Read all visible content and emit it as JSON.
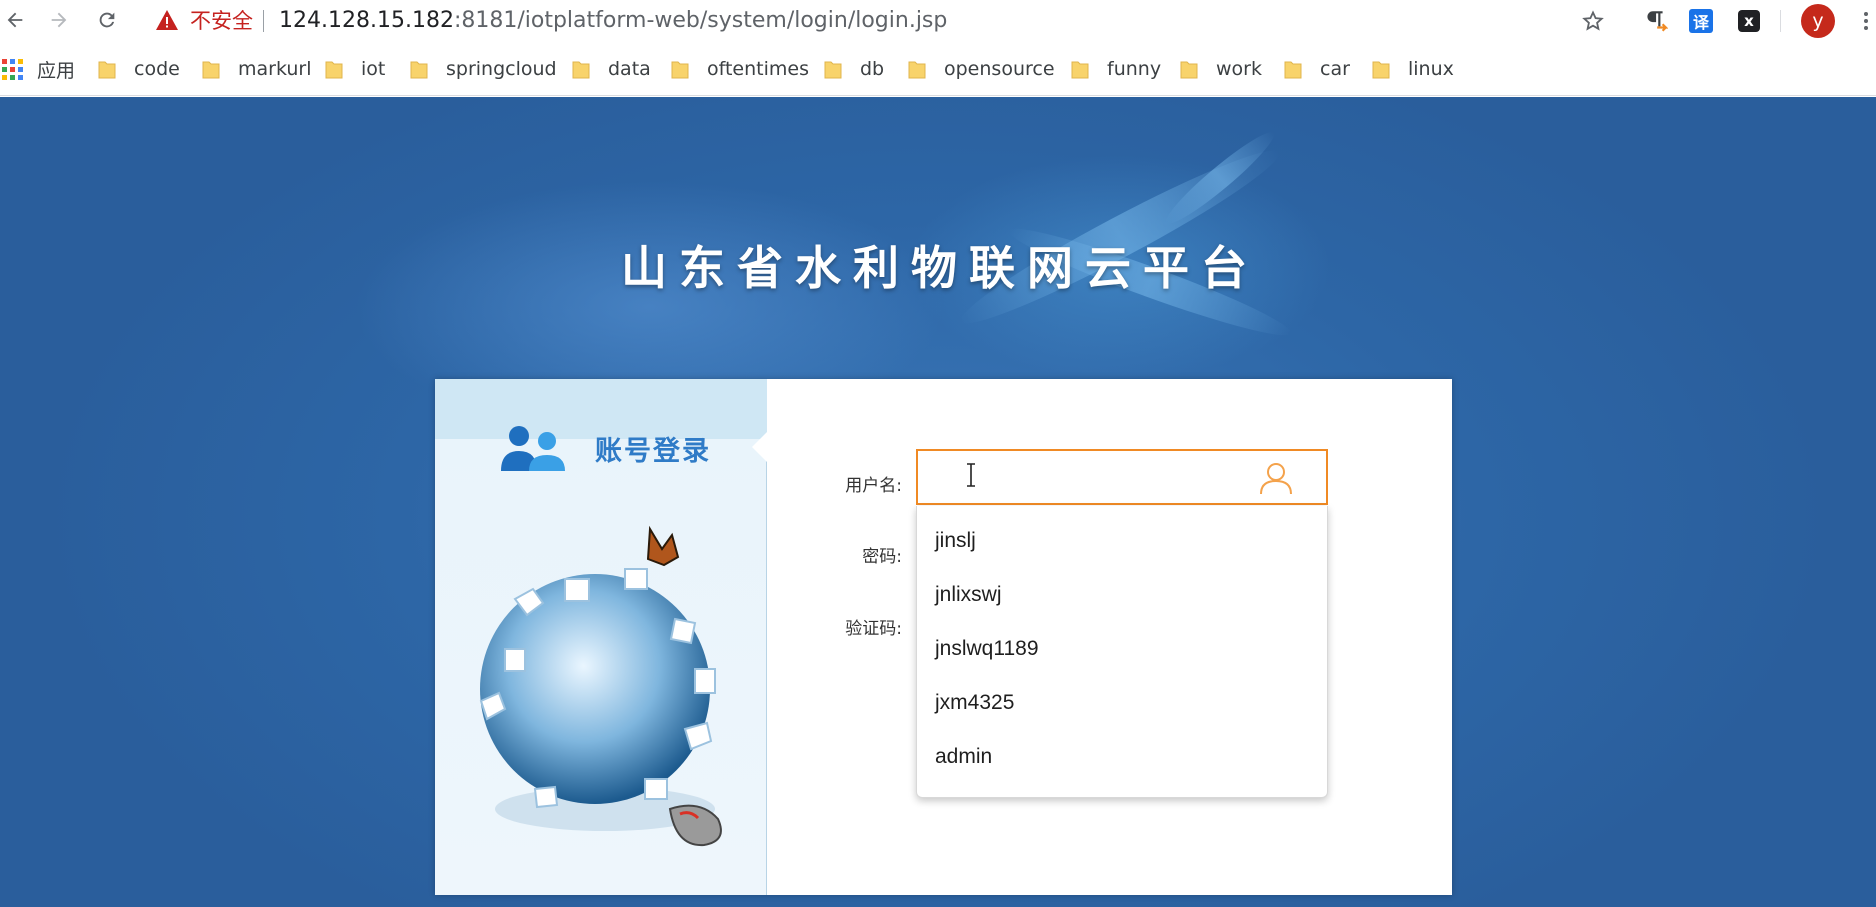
{
  "browser": {
    "security_label": "不安全",
    "url_host": "124.128.15.182",
    "url_rest": ":8181/iotplatform-web/system/login/login.jsp",
    "avatar_letter": "y",
    "translate_ext": "译",
    "x_ext": "x",
    "icons": [
      "back-icon",
      "forward-icon",
      "reload-icon",
      "warning-icon",
      "star-icon",
      "pilcrow-icon",
      "translate-icon",
      "x-extension-icon",
      "menu-dots-icon"
    ]
  },
  "bookmarks": {
    "apps_label": "应用",
    "items": [
      {
        "label": "code"
      },
      {
        "label": "markurl"
      },
      {
        "label": "iot"
      },
      {
        "label": "springcloud"
      },
      {
        "label": "data"
      },
      {
        "label": "oftentimes"
      },
      {
        "label": "db"
      },
      {
        "label": "opensource"
      },
      {
        "label": "funny"
      },
      {
        "label": "work"
      },
      {
        "label": "car"
      },
      {
        "label": "linux"
      }
    ]
  },
  "page": {
    "title": "山东省水利物联网云平台",
    "login_tab": "账号登录",
    "labels": {
      "username": "用户名:",
      "password": "密码:",
      "captcha": "验证码:"
    },
    "username_value": "",
    "suggestions": [
      "jinslj",
      "jnlixswj",
      "jnslwq1189",
      "jxm4325",
      "admin"
    ]
  },
  "colors": {
    "page_blue": "#2d66a6",
    "focus_orange": "#f08a24",
    "warning_red": "#c5221f",
    "avatar_red": "#c5291b",
    "tab_text_blue": "#2f7bc7",
    "folder_yellow": "#f8d36b"
  }
}
